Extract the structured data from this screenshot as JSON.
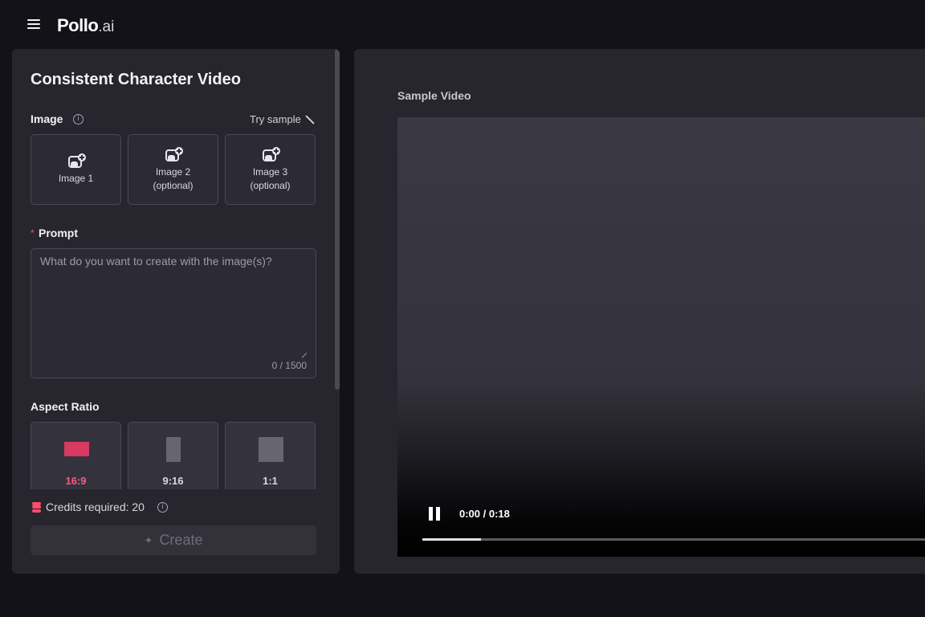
{
  "header": {
    "logo_main": "Pollo",
    "logo_suffix": ".ai",
    "menu_icon": "hamburger-menu-icon"
  },
  "form": {
    "title": "Consistent Character Video",
    "image_section": {
      "label": "Image",
      "try_sample_label": "Try sample",
      "slots": [
        {
          "label": "Image 1"
        },
        {
          "label": "Image 2\n(optional)"
        },
        {
          "label": "Image 3\n(optional)"
        }
      ]
    },
    "prompt": {
      "required_marker": "*",
      "label": "Prompt",
      "placeholder": "What do you want to create with the image(s)?",
      "value": "",
      "char_count": "0 / 1500"
    },
    "aspect_ratio": {
      "label": "Aspect Ratio",
      "options": [
        {
          "label": "16:9",
          "selected": true
        },
        {
          "label": "9:16",
          "selected": false
        },
        {
          "label": "1:1",
          "selected": false
        }
      ]
    },
    "credits": {
      "text": "Credits required: 20"
    },
    "create_label": "Create"
  },
  "sample": {
    "title": "Sample Video",
    "time": "0:00 / 0:18",
    "progress": 0.11
  },
  "colors": {
    "accent": "#ff4d6a",
    "selected_ratio": "#d83a62",
    "panel_bg": "#27262f",
    "page_bg": "#131218"
  }
}
